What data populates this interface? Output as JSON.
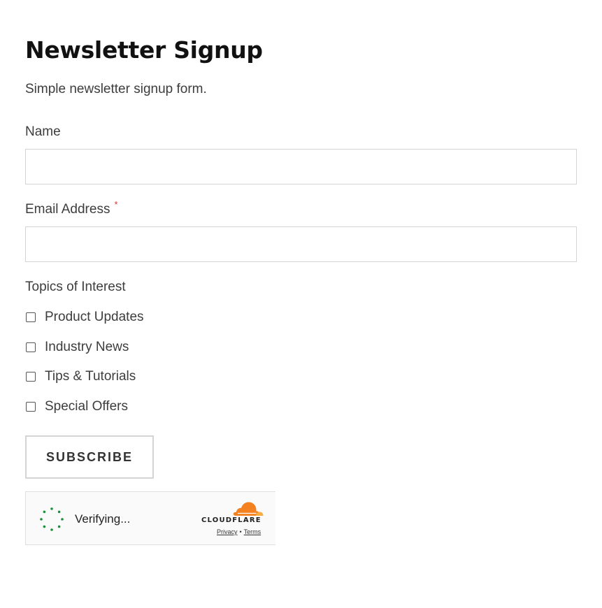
{
  "form": {
    "title": "Newsletter Signup",
    "description": "Simple newsletter signup form.",
    "fields": {
      "name": {
        "label": "Name",
        "value": "",
        "placeholder": ""
      },
      "email": {
        "label": "Email Address",
        "required_marker": "*",
        "value": "",
        "placeholder": ""
      }
    },
    "topics": {
      "label": "Topics of Interest",
      "options": [
        {
          "label": "Product Updates",
          "checked": false
        },
        {
          "label": "Industry News",
          "checked": false
        },
        {
          "label": "Tips & Tutorials",
          "checked": false
        },
        {
          "label": "Special Offers",
          "checked": false
        }
      ]
    },
    "submit_label": "SUBSCRIBE"
  },
  "captcha": {
    "status_text": "Verifying...",
    "spinner_icon": "spinner-icon",
    "provider_icon": "cloudflare-cloud-icon",
    "provider_name": "CLOUDFLARE",
    "privacy_label": "Privacy",
    "separator": "•",
    "terms_label": "Terms"
  },
  "colors": {
    "required": "#d63638",
    "spinner": "#1e8f3c",
    "cloudflare_orange": "#f48120",
    "cloudflare_light_orange": "#faad3f"
  }
}
